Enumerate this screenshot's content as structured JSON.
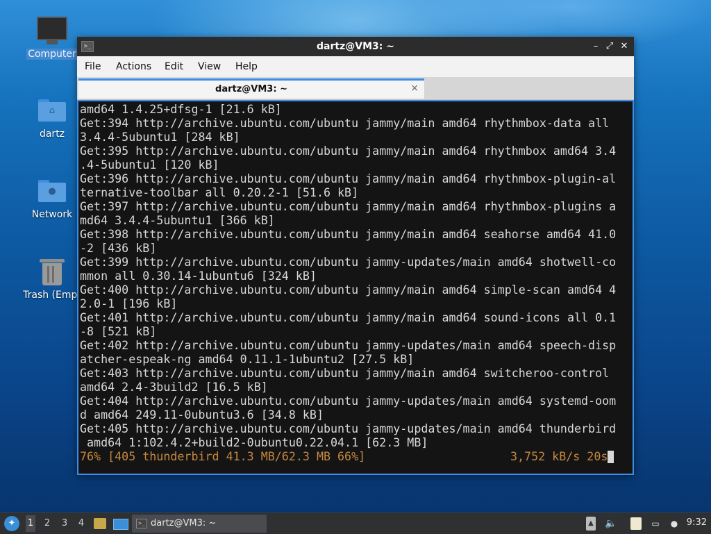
{
  "desktop": {
    "icons": [
      {
        "label": "Computer"
      },
      {
        "label": "dartz"
      },
      {
        "label": "Network"
      },
      {
        "label": "Trash (Empt"
      }
    ]
  },
  "window": {
    "title": "dartz@VM3: ~",
    "menu": [
      "File",
      "Actions",
      "Edit",
      "View",
      "Help"
    ],
    "tab_title": "dartz@VM3: ~",
    "close_glyph": "×"
  },
  "terminal": {
    "lines": [
      "amd64 1.4.25+dfsg-1 [21.6 kB]",
      "Get:394 http://archive.ubuntu.com/ubuntu jammy/main amd64 rhythmbox-data all",
      "3.4.4-5ubuntu1 [284 kB]",
      "Get:395 http://archive.ubuntu.com/ubuntu jammy/main amd64 rhythmbox amd64 3.4",
      ".4-5ubuntu1 [120 kB]",
      "Get:396 http://archive.ubuntu.com/ubuntu jammy/main amd64 rhythmbox-plugin-al",
      "ternative-toolbar all 0.20.2-1 [51.6 kB]",
      "Get:397 http://archive.ubuntu.com/ubuntu jammy/main amd64 rhythmbox-plugins a",
      "md64 3.4.4-5ubuntu1 [366 kB]",
      "Get:398 http://archive.ubuntu.com/ubuntu jammy/main amd64 seahorse amd64 41.0",
      "-2 [436 kB]",
      "Get:399 http://archive.ubuntu.com/ubuntu jammy-updates/main amd64 shotwell-co",
      "mmon all 0.30.14-1ubuntu6 [324 kB]",
      "Get:400 http://archive.ubuntu.com/ubuntu jammy/main amd64 simple-scan amd64 4",
      "2.0-1 [196 kB]",
      "Get:401 http://archive.ubuntu.com/ubuntu jammy/main amd64 sound-icons all 0.1",
      "-8 [521 kB]",
      "Get:402 http://archive.ubuntu.com/ubuntu jammy-updates/main amd64 speech-disp",
      "atcher-espeak-ng amd64 0.11.1-1ubuntu2 [27.5 kB]",
      "Get:403 http://archive.ubuntu.com/ubuntu jammy/main amd64 switcheroo-control",
      "amd64 2.4-3build2 [16.5 kB]",
      "Get:404 http://archive.ubuntu.com/ubuntu jammy-updates/main amd64 systemd-oom",
      "d amd64 249.11-0ubuntu3.6 [34.8 kB]",
      "Get:405 http://archive.ubuntu.com/ubuntu jammy-updates/main amd64 thunderbird",
      " amd64 1:102.4.2+build2-0ubuntu0.22.04.1 [62.3 MB]"
    ],
    "status_left": "76% [405 thunderbird 41.3 MB/62.3 MB 66%]",
    "status_right": "3,752 kB/s 20s",
    "status_color": "#c6883f"
  },
  "taskbar": {
    "workspaces": [
      "1",
      "2",
      "3",
      "4"
    ],
    "task_label": "dartz@VM3: ~",
    "clock": "9:32"
  },
  "icons": [
    "computer-icon",
    "home-folder-icon",
    "network-folder-icon",
    "trash-icon",
    "terminal-icon",
    "start-menu-icon",
    "volume-icon",
    "clipboard-icon",
    "network-icon",
    "notification-icon",
    "file-manager-icon",
    "show-desktop-icon",
    "eject-icon"
  ]
}
